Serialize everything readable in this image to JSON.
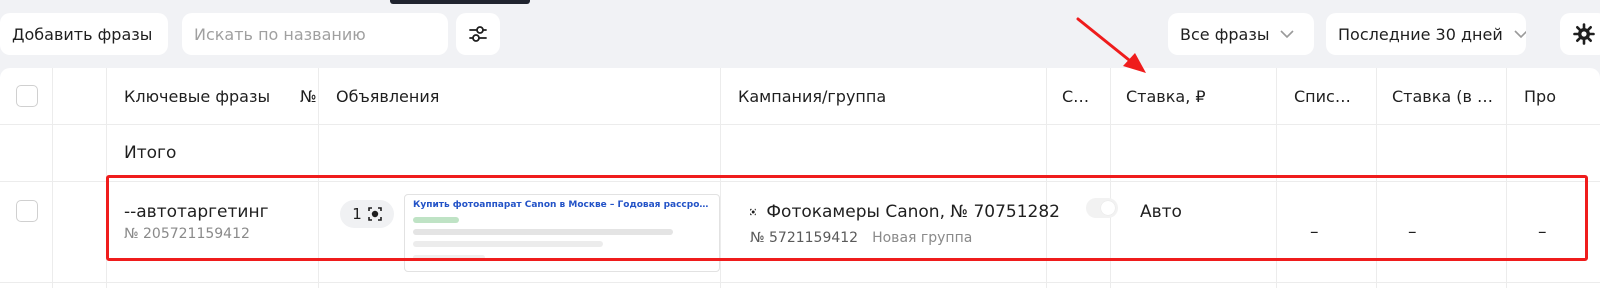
{
  "toolbar": {
    "add_label": "Добавить фразы",
    "search_placeholder": "Искать по названию",
    "phrases_filter": "Все фразы",
    "period": "Последние 30 дней"
  },
  "table": {
    "headers": {
      "phrases": "Ключевые фразы",
      "number": "№",
      "ads": "Объявления",
      "campaign": "Кампания/группа",
      "status": "С…",
      "bid": "Ставка, ₽",
      "spent": "Спис…",
      "bid_net": "Ставка (в …",
      "more": "Про"
    },
    "total_label": "Итого",
    "row": {
      "phrase": "--автотаргетинг",
      "phrase_id": "№ 205721159412",
      "ads_count": "1",
      "ad_title": "Купить фотоаппарат Canon в Москве – Годовая рассрочка п...",
      "campaign": "Фотокамеры Canon, № 70751282",
      "group_id": "№ 5721159412",
      "group_name": "Новая группа",
      "bid": "Авто",
      "spent": "–",
      "bid_net": "–",
      "more": "–"
    }
  },
  "colors": {
    "highlight": "#ef1c1c",
    "ad_title": "#2353c7"
  },
  "icons": [
    "filter-sliders-icon",
    "chevron-down-icon",
    "gear-icon",
    "autotargeting-icon",
    "annotation-arrow"
  ]
}
